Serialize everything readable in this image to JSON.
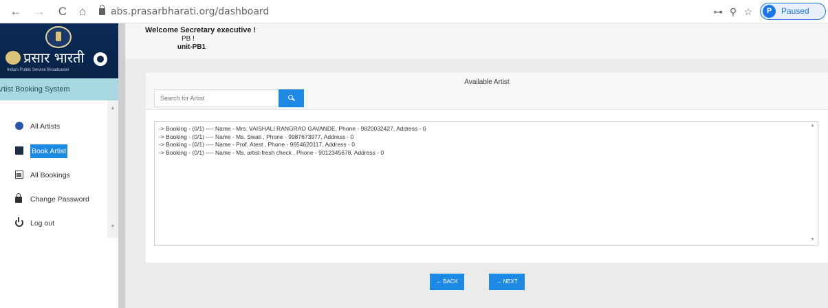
{
  "browser": {
    "back_icon": "←",
    "forward_icon": "→",
    "reload_icon": "C",
    "home_icon": "⌂",
    "url": "abs.prasarbharati.org/dashboard",
    "key_icon": "⊶",
    "zoom_icon": "⚲",
    "star_icon": "☆",
    "profile_initial": "P",
    "profile_status": "Paused"
  },
  "sidebar": {
    "logo_text": "प्रसार भारती",
    "logo_subtitle": "India's Public Service Broadcaster",
    "system_title": "Artist Booking System",
    "scroll_up": "▲",
    "scroll_down": "▼",
    "items": [
      {
        "label": "All Artists"
      },
      {
        "label": "Book Artist"
      },
      {
        "label": "All Bookings"
      },
      {
        "label": "Change Password"
      },
      {
        "label": "Log out"
      }
    ]
  },
  "welcome": {
    "line1": "Welcome Secretary executive !",
    "line2": "PB !",
    "line3": "unit-PB1"
  },
  "panel": {
    "title": "Available Artist",
    "search_placeholder": "Search for Artist",
    "results": [
      "-> Booking - (0/1) ---- Name - Mrs. VAISHALI RANGRAO GAVANDE, Phone - 9820032427, Address - 0",
      "-> Booking - (0/1) ---- Name - Ms. Swati , Phone - 9987673977, Address - 0",
      "-> Booking - (0/1) ---- Name - Prof. Atest , Phone - 9654620117, Address - 0",
      "-> Booking - (0/1) ---- Name - Ms. artist-fresh check , Phone - 9012345678, Address - 0"
    ],
    "scroll_up": "▲",
    "scroll_down": "▼"
  },
  "buttons": {
    "back": "← BACK",
    "next": "→ NEXT"
  },
  "colors": {
    "accent": "#1e88e5",
    "logo_bg": "#0a2347",
    "system_bar": "#a7d8df"
  }
}
